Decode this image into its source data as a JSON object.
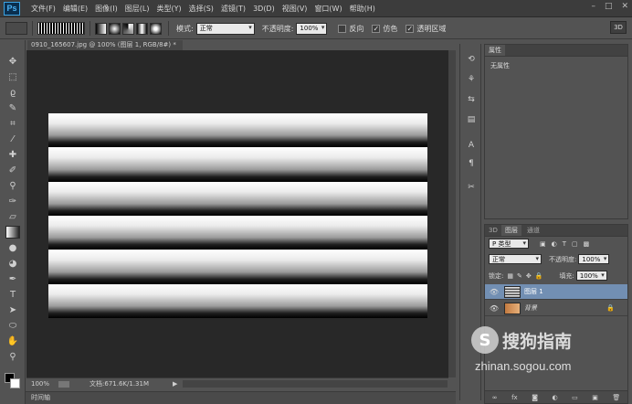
{
  "app": {
    "logo": "Ps"
  },
  "menu": [
    "文件(F)",
    "编辑(E)",
    "图像(I)",
    "图层(L)",
    "类型(Y)",
    "选择(S)",
    "滤镜(T)",
    "3D(D)",
    "视图(V)",
    "窗口(W)",
    "帮助(H)"
  ],
  "window_controls": [
    "minimize-icon",
    "maximize-icon",
    "close-icon"
  ],
  "options": {
    "mode_label": "模式:",
    "mode_value": "正常",
    "opacity_label": "不透明度:",
    "opacity_value": "100%",
    "reverse_label": "反向",
    "reverse_checked": false,
    "dither_label": "仿色",
    "dither_checked": true,
    "transparency_label": "透明区域",
    "transparency_checked": true,
    "btn_3d": "3D"
  },
  "tools": [
    "move",
    "marquee",
    "lasso",
    "quick-select",
    "crop",
    "eyedropper",
    "healing",
    "brush",
    "stamp",
    "history-brush",
    "eraser",
    "gradient",
    "blur",
    "dodge",
    "pen",
    "type",
    "path-select",
    "shape",
    "hand",
    "zoom"
  ],
  "active_tool": "gradient",
  "document": {
    "tab_title": "0910_165607.jpg @ 100% (图层 1, RGB/8#) *",
    "canvas_stripes": 6,
    "zoom": "100%",
    "doc_info": "文档:671.6K/1.31M"
  },
  "timeline_label": "时间轴",
  "properties": {
    "tab": "属性",
    "body": "无属性"
  },
  "layers": {
    "tabs": [
      "3D",
      "图层",
      "通道"
    ],
    "active_tab": "图层",
    "filter_label": "P 类型",
    "blend_mode": "正常",
    "opacity_label": "不透明度:",
    "opacity_value": "100%",
    "lock_label": "锁定:",
    "fill_label": "填充:",
    "fill_value": "100%",
    "items": [
      {
        "name": "图层 1",
        "visible": true,
        "selected": true
      },
      {
        "name": "背景",
        "visible": true,
        "selected": false,
        "locked": true
      }
    ]
  },
  "watermark": {
    "name": "搜狗指南",
    "url": "zhinan.sogou.com"
  }
}
